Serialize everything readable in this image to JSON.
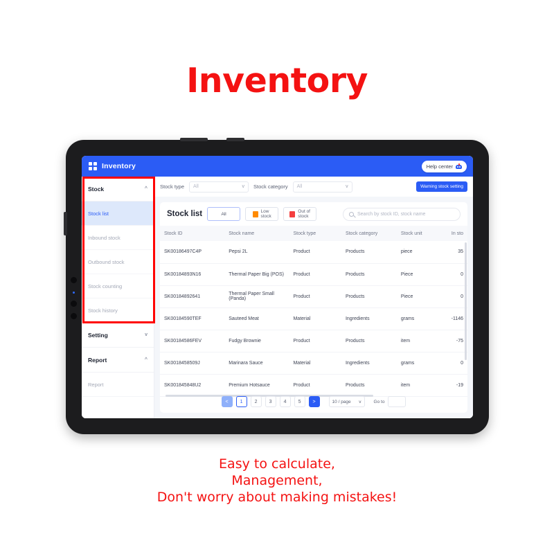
{
  "promo": {
    "headline": "Inventory",
    "caption_lines": [
      "Easy to calculate,",
      "Management,",
      "Don't worry about making mistakes!"
    ],
    "headline_color": "#f41212"
  },
  "topbar": {
    "app_icon": "grid-2x2-icon",
    "title": "Inventory",
    "help_label": "Help center",
    "help_icon": "headset-robot-icon",
    "brand_color": "#2b5cf5"
  },
  "sidebar": {
    "groups": [
      {
        "label": "Stock",
        "chevron": "^",
        "items": [
          {
            "label": "Stock list",
            "active": true
          },
          {
            "label": "Inbound stock",
            "active": false
          },
          {
            "label": "Outbound stock",
            "active": false
          },
          {
            "label": "Stock counting",
            "active": false
          },
          {
            "label": "Stock history",
            "active": false
          }
        ]
      },
      {
        "label": "Setting",
        "chevron": "v",
        "items": []
      },
      {
        "label": "Report",
        "chevron": "^",
        "items": [
          {
            "label": "Report",
            "active": false
          }
        ]
      }
    ],
    "highlight_color": "#ff0000"
  },
  "filterbar": {
    "stock_type_label": "Stock type",
    "stock_type_value": "All",
    "stock_category_label": "Stock category",
    "stock_category_value": "All",
    "chevron": "v",
    "warning_button": "Warning stock setting"
  },
  "panel": {
    "title": "Stock list",
    "tabs": [
      {
        "label": "All",
        "selected": true,
        "color": ""
      },
      {
        "label_line1": "Low",
        "label_line2": "stock",
        "selected": false,
        "color": "#ff8a00"
      },
      {
        "label_line1": "Out of",
        "label_line2": "stock",
        "selected": false,
        "color": "#f43f3f"
      }
    ],
    "search_placeholder": "Search by stock ID, stock name",
    "search_value": "",
    "search_icon": "magnifier-icon"
  },
  "table": {
    "columns": [
      "Stock ID",
      "Stock name",
      "Stock type",
      "Stock category",
      "Stock unit",
      "In sto"
    ],
    "rows": [
      {
        "id": "SK00186497C4P",
        "name": "Pepsi 2L",
        "type": "Product",
        "category": "Products",
        "unit": "piece",
        "in_stock": "35"
      },
      {
        "id": "SK00184893N16",
        "name": "Thermal Paper Big (POS)",
        "type": "Product",
        "category": "Products",
        "unit": "Piece",
        "in_stock": "0"
      },
      {
        "id": "SK00184892641",
        "name": "Thermal Paper Small (Panda)",
        "type": "Product",
        "category": "Products",
        "unit": "Piece",
        "in_stock": "0"
      },
      {
        "id": "SK00184590TEF",
        "name": "Sauteed Meat",
        "type": "Material",
        "category": "Ingredients",
        "unit": "grams",
        "in_stock": "-1146"
      },
      {
        "id": "SK00184586FEV",
        "name": "Fudgy Brownie",
        "type": "Product",
        "category": "Products",
        "unit": "item",
        "in_stock": "-75"
      },
      {
        "id": "SK0018458509J",
        "name": "Marinara Sauce",
        "type": "Material",
        "category": "Ingredients",
        "unit": "grams",
        "in_stock": "0"
      },
      {
        "id": "SK001845848U2",
        "name": "Premium Hotsauce",
        "type": "Product",
        "category": "Products",
        "unit": "item",
        "in_stock": "-19"
      }
    ]
  },
  "pagination": {
    "prev": "<",
    "pages": [
      "1",
      "2",
      "3",
      "4",
      "5"
    ],
    "current_page": "1",
    "next": ">",
    "per_page": "10 / page",
    "per_page_chevron": "v",
    "goto_label": "Go to",
    "goto_value": ""
  }
}
